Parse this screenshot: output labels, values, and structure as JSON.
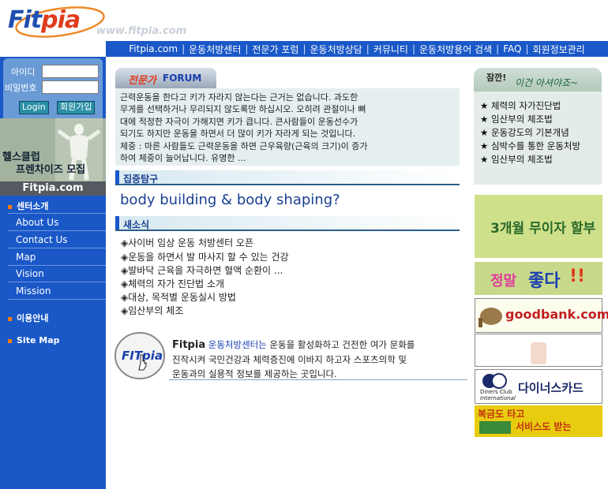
{
  "header": {
    "logo_text_a": "Fit",
    "logo_text_b": "pia",
    "site_url": "www.fitpia.com"
  },
  "topnav": {
    "items": [
      "Fitpia.com",
      "운동처방센터",
      "전문가 포럼",
      "운동처방상담",
      "커뮤니티",
      "운동처방용어 검색",
      "FAQ",
      "회원정보관리"
    ]
  },
  "login": {
    "id_label": "아이디",
    "pw_label": "비밀번호",
    "login_button": "Login",
    "signup_button": "회원가입"
  },
  "promo": {
    "line1": "헬스클럽",
    "line2": "프렌차이즈 모집"
  },
  "sidebar": {
    "site_name": "Fitpia.com",
    "section1": "센터소개",
    "links": [
      "About Us",
      "Contact Us",
      "Map",
      "Vision",
      "Mission"
    ],
    "section2": "이용안내",
    "section3": "Site Map"
  },
  "forum": {
    "tab_label_a": "전문가",
    "tab_label_b": "FORUM",
    "lines": [
      "근력운동을 한다고 키가 자라지 않는다는 근거는 없습니다. 과도한",
      "무게를 선택하거나 무리되지 않도록만 하십시오. 오히려 관절이나 뼈",
      "대에 적정한 자극이 가해지면 키가 큽니다. 큰사람들이 운동선수가",
      "되기도 하지만 운동을 하면서 더 많이 키가 자라게 되는 것입니다.",
      "체중 : 마른 사람들도 근력운동을 하면 근우육량(근육의 크기)이 증가",
      "하여 체중이 늘어납니다. 유명한 ..."
    ]
  },
  "feature": {
    "header": "집중탐구",
    "title": "body building & body shaping?"
  },
  "news": {
    "header": "새소식",
    "items": [
      "◈사이버 임상 운동 처방센터 오픈",
      "◈운동을 하면서 발 마사지 할 수 있는 건강",
      "◈발바닥 근육을 자극하면 혈액 순환이 ...",
      "◈체력의 자가 진단법 소개",
      "◈대상, 목적별 운동실시 방법",
      "◈임산부의 체조"
    ]
  },
  "about": {
    "badge": "FITpia",
    "name": "Fitpia",
    "line1_highlight": "운동처방센터는",
    "line1_rest": "운동을 활성화하고 건전한 여가 문화를",
    "line2": "진작시켜 국민건강과 체력증진에 이바지 하고자 스포츠의학 및",
    "line3": "운동과의 실용적 정보를 제공하는 곳입니다."
  },
  "tips": {
    "head_a": "잠깐!",
    "head_b": "이건 아셔야죠~",
    "items": [
      "★ 체력의 자가진단법",
      "★ 임산부의 체조법",
      "★ 운동강도의 기본개념",
      "★ 심박수를 통한 운동처방",
      "★ 임산부의 체조법"
    ]
  },
  "banners": {
    "b1": "3개월 무이자 할부",
    "b2_a": "정말",
    "b2_b": "좋다",
    "b2_c": "!!",
    "b3": "goodbank.com",
    "b5_a": "Diners Club",
    "b5_b": "International",
    "b5_c": "다이너스카드",
    "b6_a": "복금도 타고",
    "b6_b": "서비스도 받는"
  },
  "colors": {
    "nav_blue": "#1a58c8",
    "logo_red": "#e03c1c",
    "heading_navy": "#1a3f90"
  }
}
